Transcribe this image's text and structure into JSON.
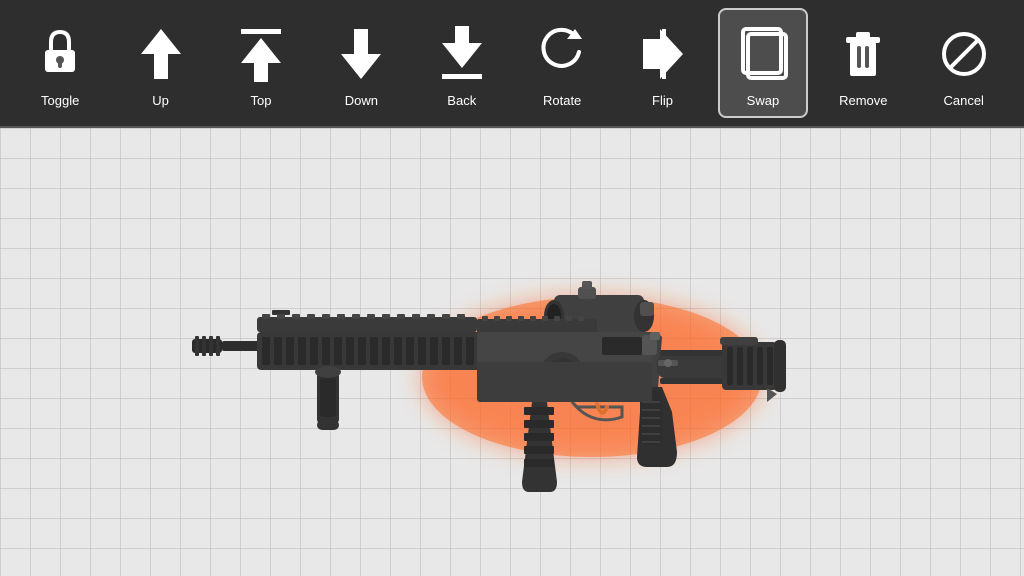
{
  "toolbar": {
    "buttons": [
      {
        "id": "toggle",
        "label": "Toggle",
        "icon": "lock"
      },
      {
        "id": "up",
        "label": "Up",
        "icon": "up"
      },
      {
        "id": "top",
        "label": "Top",
        "icon": "top"
      },
      {
        "id": "down",
        "label": "Down",
        "icon": "down"
      },
      {
        "id": "back",
        "label": "Back",
        "icon": "back"
      },
      {
        "id": "rotate",
        "label": "Rotate",
        "icon": "rotate"
      },
      {
        "id": "flip",
        "label": "Flip",
        "icon": "flip"
      },
      {
        "id": "swap",
        "label": "Swap",
        "icon": "swap",
        "active": true
      },
      {
        "id": "remove",
        "label": "Remove",
        "icon": "remove"
      },
      {
        "id": "cancel",
        "label": "Cancel",
        "icon": "cancel"
      }
    ]
  },
  "canvas": {
    "background": "#e8e8e8"
  }
}
